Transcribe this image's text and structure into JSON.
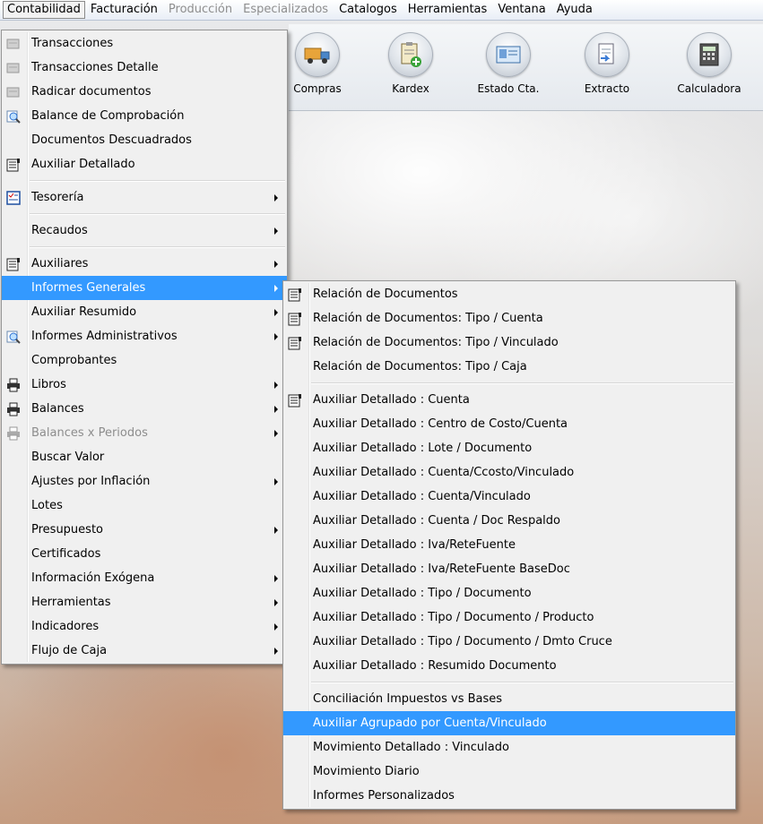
{
  "menubar": {
    "items": [
      {
        "label": "Contabilidad",
        "state": "active"
      },
      {
        "label": "Facturación",
        "state": "normal"
      },
      {
        "label": "Producción",
        "state": "disabled"
      },
      {
        "label": "Especializados",
        "state": "disabled"
      },
      {
        "label": "Catalogos",
        "state": "normal"
      },
      {
        "label": "Herramientas",
        "state": "normal"
      },
      {
        "label": "Ventana",
        "state": "normal"
      },
      {
        "label": "Ayuda",
        "state": "normal"
      }
    ]
  },
  "toolbar": {
    "buttons": [
      {
        "label": "Compras",
        "icon": "truck-icon"
      },
      {
        "label": "Kardex",
        "icon": "clipboard-add-icon"
      },
      {
        "label": "Estado Cta.",
        "icon": "id-card-icon"
      },
      {
        "label": "Extracto",
        "icon": "document-icon"
      },
      {
        "label": "Calculadora",
        "icon": "calculator-icon"
      }
    ]
  },
  "menu_main": {
    "items": [
      {
        "label": "Transacciones",
        "icon": "disabled-document-icon",
        "submenu": false
      },
      {
        "label": "Transacciones Detalle",
        "icon": "disabled-document-icon",
        "submenu": false
      },
      {
        "label": "Radicar documentos",
        "icon": "disabled-document-icon",
        "submenu": false
      },
      {
        "label": "Balance de Comprobación",
        "icon": "magnifier-icon",
        "submenu": false
      },
      {
        "label": "Documentos Descuadrados",
        "icon": "",
        "submenu": false
      },
      {
        "label": "Auxiliar Detallado",
        "icon": "ledger-icon",
        "submenu": false
      },
      {
        "label": "Tesorería",
        "icon": "checklist-icon",
        "submenu": true
      },
      {
        "label": "Recaudos",
        "icon": "",
        "submenu": true
      },
      {
        "label": "Auxiliares",
        "icon": "ledger-icon",
        "submenu": true
      },
      {
        "label": "Informes Generales",
        "icon": "",
        "submenu": true
      },
      {
        "label": "Auxiliar Resumido",
        "icon": "",
        "submenu": true
      },
      {
        "label": "Informes Administrativos",
        "icon": "magnifier-icon",
        "submenu": true
      },
      {
        "label": "Comprobantes",
        "icon": "",
        "submenu": false
      },
      {
        "label": "Libros",
        "icon": "printer-icon",
        "submenu": true
      },
      {
        "label": "Balances",
        "icon": "printer-icon",
        "submenu": true
      },
      {
        "label": "Balances x Periodos",
        "icon": "printer-icon",
        "submenu": true
      },
      {
        "label": "Buscar Valor",
        "icon": "",
        "submenu": false
      },
      {
        "label": "Ajustes por Inflación",
        "icon": "",
        "submenu": true
      },
      {
        "label": "Lotes",
        "icon": "",
        "submenu": false
      },
      {
        "label": "Presupuesto",
        "icon": "",
        "submenu": true
      },
      {
        "label": "Certificados",
        "icon": "",
        "submenu": false
      },
      {
        "label": "Información Exógena",
        "icon": "",
        "submenu": true
      },
      {
        "label": "Herramientas",
        "icon": "",
        "submenu": true
      },
      {
        "label": "Indicadores",
        "icon": "",
        "submenu": true
      },
      {
        "label": "Flujo de Caja",
        "icon": "",
        "submenu": true
      }
    ]
  },
  "menu_sub": {
    "items": [
      {
        "label": "Relación de Documentos",
        "icon": "ledger-icon"
      },
      {
        "label": "Relación de Documentos: Tipo / Cuenta",
        "icon": "ledger-icon"
      },
      {
        "label": "Relación de Documentos: Tipo / Vinculado",
        "icon": "ledger-icon"
      },
      {
        "label": "Relación de Documentos: Tipo / Caja",
        "icon": ""
      },
      {
        "label": "Auxiliar Detallado : Cuenta",
        "icon": "ledger-icon"
      },
      {
        "label": "Auxiliar Detallado : Centro de Costo/Cuenta",
        "icon": ""
      },
      {
        "label": "Auxiliar Detallado : Lote / Documento",
        "icon": ""
      },
      {
        "label": "Auxiliar Detallado : Cuenta/Ccosto/Vinculado",
        "icon": ""
      },
      {
        "label": "Auxiliar Detallado : Cuenta/Vinculado",
        "icon": ""
      },
      {
        "label": "Auxiliar Detallado : Cuenta / Doc Respaldo",
        "icon": ""
      },
      {
        "label": "Auxiliar Detallado : Iva/ReteFuente",
        "icon": ""
      },
      {
        "label": "Auxiliar Detallado : Iva/ReteFuente BaseDoc",
        "icon": ""
      },
      {
        "label": "Auxiliar Detallado : Tipo / Documento",
        "icon": ""
      },
      {
        "label": "Auxiliar Detallado : Tipo / Documento / Producto",
        "icon": ""
      },
      {
        "label": "Auxiliar Detallado : Tipo / Documento / Dmto Cruce",
        "icon": ""
      },
      {
        "label": "Auxiliar Detallado :  Resumido Documento",
        "icon": ""
      },
      {
        "label": "Conciliación Impuestos vs Bases",
        "icon": ""
      },
      {
        "label": "Auxiliar Agrupado por Cuenta/Vinculado",
        "icon": ""
      },
      {
        "label": "Movimiento Detallado :  Vinculado",
        "icon": ""
      },
      {
        "label": "Movimiento Diario",
        "icon": ""
      },
      {
        "label": "Informes Personalizados",
        "icon": ""
      }
    ]
  },
  "colors": {
    "highlight": "#3399ff",
    "menu_bg": "#f0f0f0"
  }
}
